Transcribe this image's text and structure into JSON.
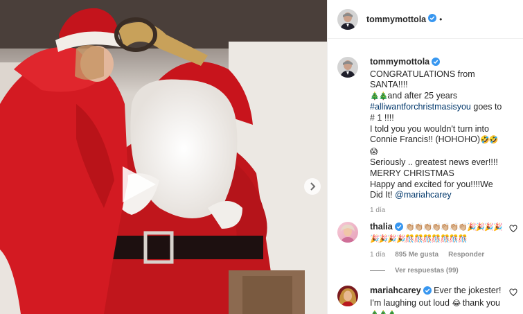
{
  "post": {
    "username": "tommymottola",
    "follow_dot": "•"
  },
  "caption": {
    "username": "tommymottola",
    "line1": "CONGRATULATIONS from SANTA!!!!",
    "line2_emoji": "🎄🎄",
    "line2_text": "and after 25 years",
    "hashtag": "#alliwantforchristmasisyou",
    "line3_rest": " goes to # 1 !!!!",
    "line4": "I told you you wouldn't turn into Connie Francis!! (HOHOHO)",
    "line4_emoji": "🤣🤣😱",
    "line5": "Seriously .. greatest news ever!!!!",
    "line6": "MERRY CHRISTMAS",
    "line7": "Happy and excited for you!!!!We Did It!",
    "mention": "@mariahcarey",
    "time": "1 día"
  },
  "comments": [
    {
      "username": "thalia",
      "emoji": "👏🏼👏🏼👏🏼👏🏼👏🏼👏🏼👏🏼🎉🎉🎉🎉🎉🎉🎉🎉🎊🎊🎊🎊🎊🎊🎊",
      "time": "1 día",
      "likes": "895 Me gusta",
      "reply": "Responder",
      "view_replies": "Ver respuestas (99)"
    },
    {
      "username": "mariahcarey",
      "text": "Ever the jokester! I'm laughing out loud",
      "emoji1": "😂",
      "text2": "thank you",
      "emoji2": "🎄🎄🎄"
    }
  ],
  "colors": {
    "verified_blue": "#3897f0",
    "link_blue": "#00376b",
    "meta_gray": "#8e8e8e"
  },
  "icons": {
    "play": "play-icon",
    "next": "chevron-right-icon",
    "heart": "heart-icon",
    "verified": "verified-badge-icon"
  }
}
